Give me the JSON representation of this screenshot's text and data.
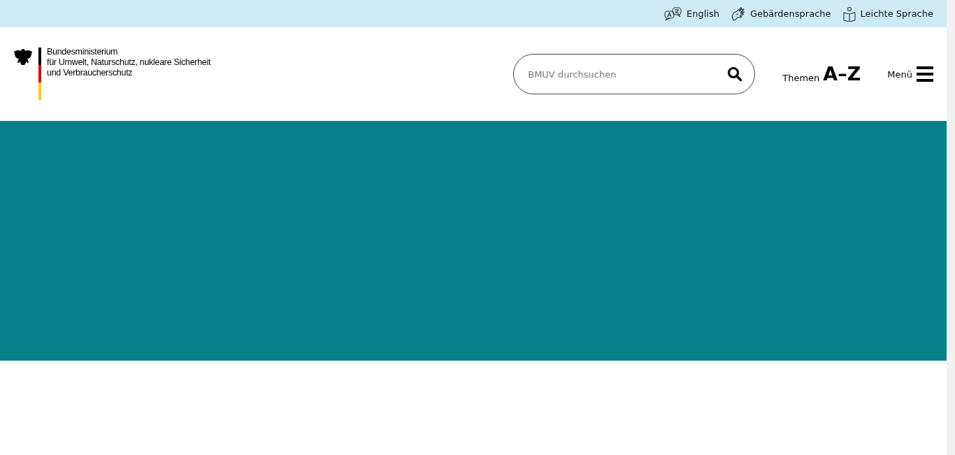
{
  "top_links": [
    {
      "kind": "language",
      "label": "English"
    },
    {
      "kind": "sign-language",
      "label": "Gebärdensprache"
    },
    {
      "kind": "easy-language",
      "label": "Leichte Sprache"
    }
  ],
  "logo": {
    "lines": [
      "Bundesministerium",
      "für Umwelt, Naturschutz, nukleare Sicherheit",
      "und Verbraucherschutz"
    ]
  },
  "search": {
    "placeholder": "BMUV durchsuchen"
  },
  "topics_link": {
    "label": "Themen",
    "emphasis": "A–Z"
  },
  "menu_button": {
    "label": "Menü"
  }
}
